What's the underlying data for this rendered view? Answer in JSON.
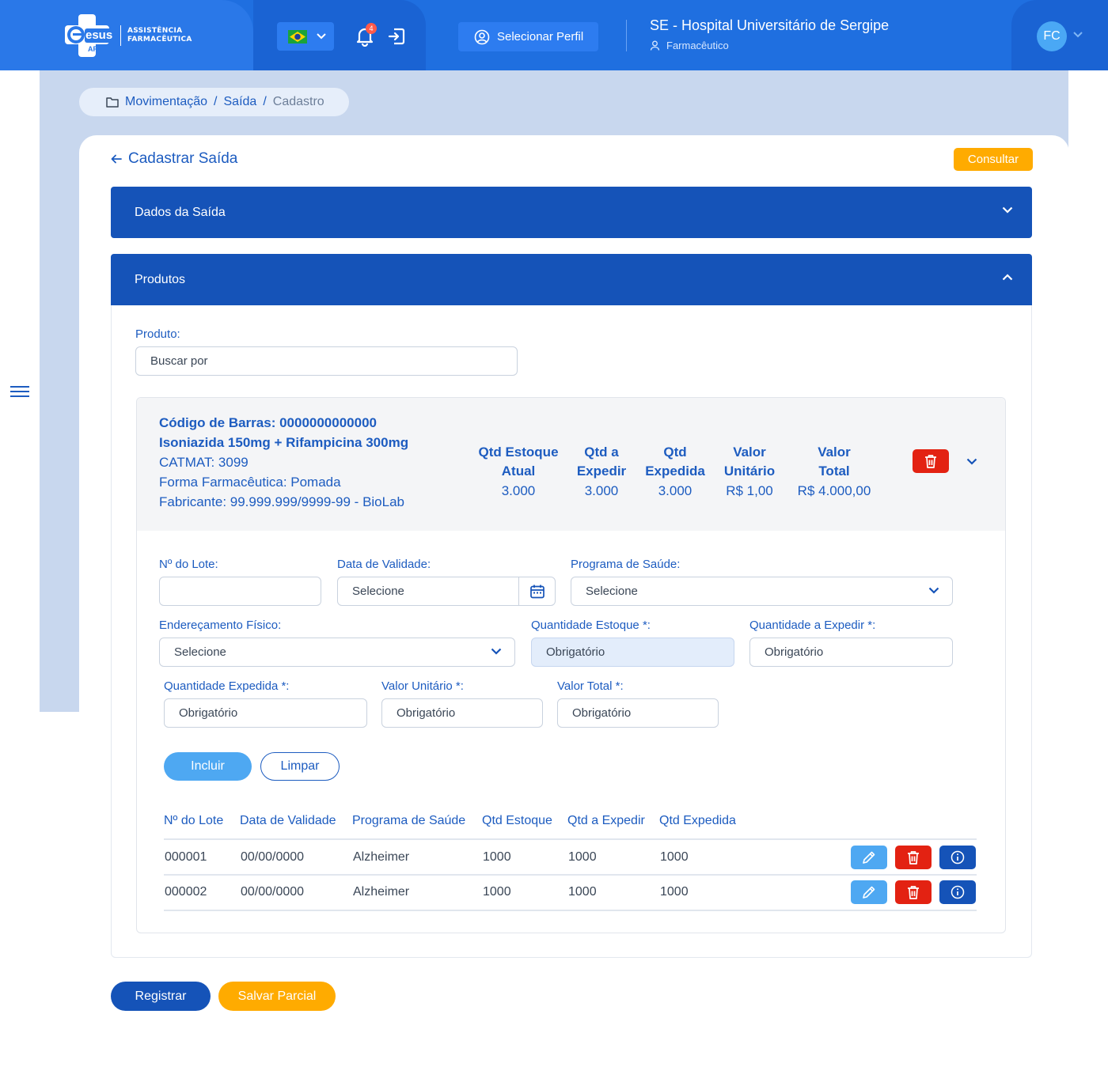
{
  "header": {
    "logo_brand": "esus",
    "logo_sub": "AF",
    "logo_line1": "ASSISTÊNCIA",
    "logo_line2": "FARMACÊUTICA",
    "notification_count": "4",
    "profile_button": "Selecionar Perfil",
    "hospital": "SE - Hospital Universitário de Sergipe",
    "role": "Farmacêutico",
    "avatar_initials": "FC"
  },
  "breadcrumb": {
    "part1": "Movimentação",
    "sep": "/",
    "part2": "Saída",
    "part3": "Cadastro"
  },
  "page": {
    "title": "Cadastrar Saída",
    "consultar": "Consultar"
  },
  "sections": {
    "dados": "Dados da Saída",
    "produtos": "Produtos"
  },
  "produto_search": {
    "label": "Produto:",
    "placeholder": "Buscar por"
  },
  "product": {
    "barcode": "Código de Barras: 0000000000000",
    "name": "Isoniazida 150mg + Rifampicina 300mg",
    "catmat": "CATMAT: 3099",
    "forma": "Forma Farmacêutica: Pomada",
    "fabricante": "Fabricante: 99.999.999/9999-99 - BioLab",
    "columns": [
      {
        "h1": "Qtd Estoque",
        "h2": "Atual",
        "value": "3.000"
      },
      {
        "h1": "Qtd a",
        "h2": "Expedir",
        "value": "3.000"
      },
      {
        "h1": "Qtd",
        "h2": "Expedida",
        "value": "3.000"
      },
      {
        "h1": "Valor",
        "h2": "Unitário",
        "value": "R$ 1,00"
      },
      {
        "h1": "Valor",
        "h2": "Total",
        "value": "R$ 4.000,00"
      }
    ]
  },
  "form": {
    "lote_label": "Nº do Lote:",
    "validade_label": "Data de Validade:",
    "validade_placeholder": "Selecione",
    "programa_label": "Programa de Saúde:",
    "programa_placeholder": "Selecione",
    "endereco_label": "Endereçamento Físico:",
    "endereco_placeholder": "Selecione",
    "qtd_estoque_label": "Quantidade Estoque *:",
    "qtd_estoque_placeholder": "Obrigatório",
    "qtd_expedir_label": "Quantidade a Expedir *:",
    "qtd_expedir_placeholder": "Obrigatório",
    "qtd_expedida_label": "Quantidade Expedida *:",
    "qtd_expedida_placeholder": "Obrigatório",
    "valor_unitario_label": "Valor Unitário *:",
    "valor_unitario_placeholder": "Obrigatório",
    "valor_total_label": "Valor Total *:",
    "valor_total_placeholder": "Obrigatório",
    "incluir": "Incluir",
    "limpar": "Limpar"
  },
  "table": {
    "headers": [
      "Nº do Lote",
      "Data de Validade",
      "Programa de Saúde",
      "Qtd Estoque",
      "Qtd a Expedir",
      "Qtd Expedida"
    ],
    "rows": [
      [
        "000001",
        "00/00/0000",
        "Alzheimer",
        "1000",
        "1000",
        "1000"
      ],
      [
        "000002",
        "00/00/0000",
        "Alzheimer",
        "1000",
        "1000",
        "1000"
      ]
    ]
  },
  "footer": {
    "registrar": "Registrar",
    "salvar": "Salvar Parcial"
  },
  "colors": {
    "primary": "#1553b8",
    "accent": "#ffab00",
    "danger": "#e32212",
    "light_blue": "#4ea8f2"
  }
}
